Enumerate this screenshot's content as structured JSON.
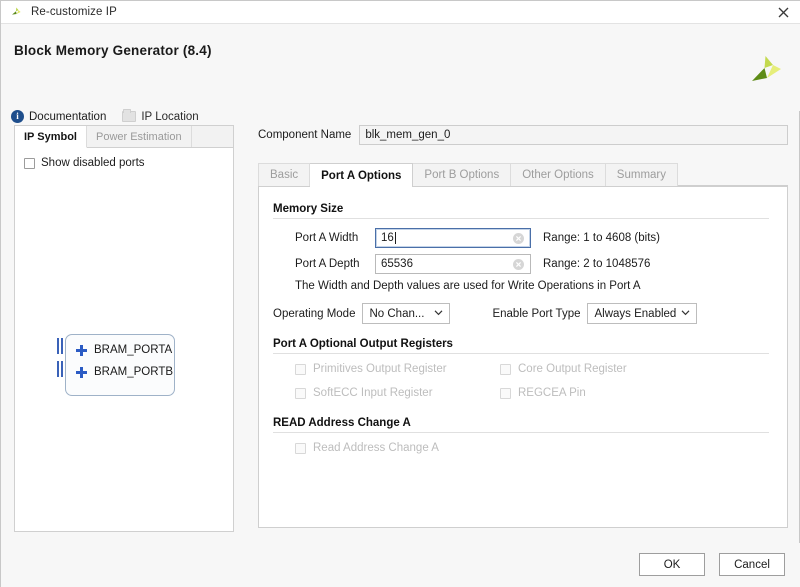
{
  "window": {
    "title": "Re-customize IP",
    "close_icon": "close-icon",
    "app_icon": "xilinx-logo-icon"
  },
  "header": {
    "title": "Block Memory Generator (8.4)",
    "logo_icon": "xilinx-leaf-logo",
    "links": [
      {
        "label": "Documentation",
        "icon": "info-icon"
      },
      {
        "label": "IP Location",
        "icon": "folder-icon"
      }
    ]
  },
  "left_panel": {
    "tabs": [
      {
        "label": "IP Symbol",
        "active": true
      },
      {
        "label": "Power Estimation",
        "active": false
      }
    ],
    "show_disabled_ports": {
      "label": "Show disabled ports",
      "checked": false
    },
    "symbol": {
      "ports": [
        {
          "label": "BRAM_PORTA",
          "expand_icon": "plus-icon"
        },
        {
          "label": "BRAM_PORTB",
          "expand_icon": "plus-icon"
        }
      ]
    }
  },
  "main": {
    "component_name": {
      "label": "Component Name",
      "value": "blk_mem_gen_0"
    },
    "tabs": [
      {
        "label": "Basic",
        "active": false
      },
      {
        "label": "Port A Options",
        "active": true
      },
      {
        "label": "Port B Options",
        "active": false
      },
      {
        "label": "Other Options",
        "active": false
      },
      {
        "label": "Summary",
        "active": false
      }
    ],
    "memory_size": {
      "title": "Memory Size",
      "width": {
        "label": "Port A Width",
        "value": "16",
        "hint": "Range: 1 to 4608 (bits)"
      },
      "depth": {
        "label": "Port A Depth",
        "value": "65536",
        "hint": "Range: 2 to 1048576"
      },
      "note": "The Width and Depth values are used for Write Operations in Port A",
      "operating_mode": {
        "label": "Operating Mode",
        "value": "No Chan..."
      },
      "enable_port_type": {
        "label": "Enable Port Type",
        "value": "Always Enabled"
      }
    },
    "optional_registers": {
      "title": "Port A Optional Output Registers",
      "items": [
        {
          "label": "Primitives Output Register",
          "checked": false,
          "disabled": true
        },
        {
          "label": "Core Output Register",
          "checked": false,
          "disabled": true
        },
        {
          "label": "SoftECC Input Register",
          "checked": false,
          "disabled": true
        },
        {
          "label": "REGCEA Pin",
          "checked": false,
          "disabled": true
        }
      ]
    },
    "read_address_change": {
      "title": "READ Address Change A",
      "items": [
        {
          "label": "Read Address Change A",
          "checked": false,
          "disabled": true
        }
      ]
    }
  },
  "footer": {
    "ok_label": "OK",
    "cancel_label": "Cancel"
  },
  "colors": {
    "accent_blue": "#2b5bc4",
    "logo_green": "#9ec63b",
    "info_blue": "#1e4e8c"
  }
}
